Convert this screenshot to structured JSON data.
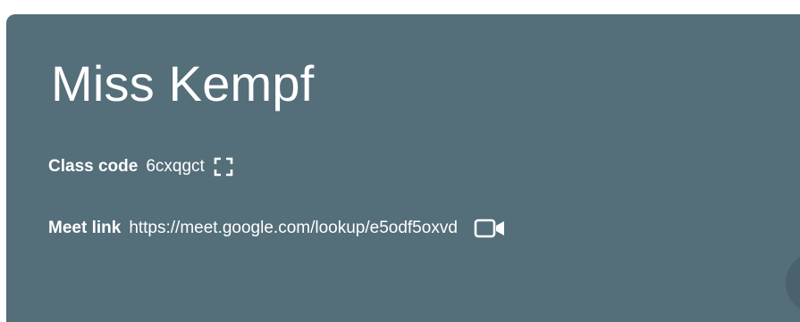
{
  "class": {
    "name": "Miss Kempf",
    "class_code_label": "Class code",
    "class_code": "6cxqgct",
    "meet_link_label": "Meet link",
    "meet_link": "https://meet.google.com/lookup/e5odf5oxvd"
  },
  "icons": {
    "class_code_action": "fullscreen-icon",
    "meet_action": "video-camera-icon"
  },
  "colors": {
    "banner": "#546e7a",
    "text": "#ffffff"
  }
}
